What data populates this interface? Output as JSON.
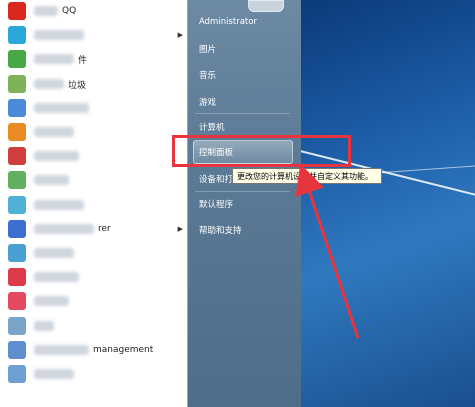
{
  "programs": [
    {
      "id": "qq",
      "icon_color": "#d8281f",
      "text": "QQ",
      "blur_width": 24
    },
    {
      "id": "p2",
      "icon_color": "#2aa7d8",
      "text": "",
      "blur_width": 50,
      "has_arrow": true
    },
    {
      "id": "p3",
      "icon_color": "#47a846",
      "text": "件",
      "blur_width": 40
    },
    {
      "id": "p4",
      "icon_color": "#7fb35a",
      "text": "垃圾",
      "blur_width": 30
    },
    {
      "id": "p5",
      "icon_color": "#4a8ad8",
      "text": "",
      "blur_width": 55
    },
    {
      "id": "p6",
      "icon_color": "#e98c25",
      "text": "",
      "blur_width": 40
    },
    {
      "id": "p7",
      "icon_color": "#cf3d3d",
      "text": "",
      "blur_width": 45
    },
    {
      "id": "p8",
      "icon_color": "#61b05f",
      "text": "",
      "blur_width": 35
    },
    {
      "id": "p9",
      "icon_color": "#4fb1d6",
      "text": "",
      "blur_width": 50
    },
    {
      "id": "p10",
      "icon_color": "#3c6fcf",
      "text": "rer",
      "blur_width": 60,
      "has_arrow": true
    },
    {
      "id": "p11",
      "icon_color": "#49a0d4",
      "text": "",
      "blur_width": 40
    },
    {
      "id": "p12",
      "icon_color": "#dd3a4a",
      "text": "",
      "blur_width": 45
    },
    {
      "id": "p13",
      "icon_color": "#e44b60",
      "text": "",
      "blur_width": 35
    },
    {
      "id": "p14",
      "icon_color": "#7aa4c8",
      "text": "",
      "blur_width": 20
    },
    {
      "id": "p15",
      "icon_color": "#5d8fd0",
      "text": "management",
      "blur_width": 55
    },
    {
      "id": "p16",
      "icon_color": "#6ca0d3",
      "text": "",
      "blur_width": 40
    }
  ],
  "right_menu": {
    "user": "Administrator",
    "pictures": "图片",
    "music": "音乐",
    "games": "游戏",
    "computer": "计算机",
    "control_panel": "控制面板",
    "devices_printers": "设备和打",
    "default_programs": "默认程序",
    "help_support": "帮助和支持"
  },
  "tooltip": "更改您的计算机设置并自定义其功能。",
  "colors": {
    "highlight_box": "#e8343d",
    "arrow": "#e8343d"
  }
}
